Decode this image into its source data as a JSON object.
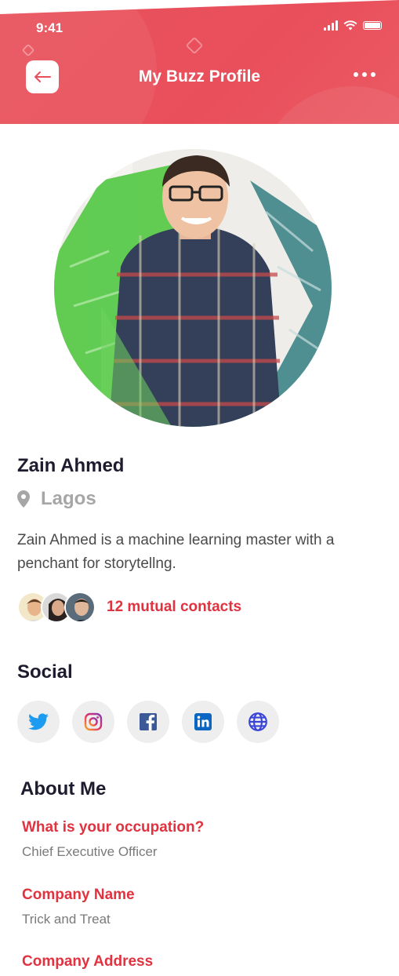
{
  "status_bar": {
    "time": "9:41"
  },
  "header": {
    "title": "My Buzz Profile"
  },
  "profile": {
    "name": "Zain Ahmed",
    "location": "Lagos",
    "bio": "Zain Ahmed is a machine learning master with a penchant for storytellng.",
    "mutual_contacts": "12 mutual contacts"
  },
  "social": {
    "title": "Social",
    "links": [
      "twitter-icon",
      "instagram-icon",
      "facebook-icon",
      "linkedin-icon",
      "globe-icon"
    ]
  },
  "about": {
    "title": "About Me",
    "items": [
      {
        "question": "What is your occupation?",
        "answer": "Chief Executive Officer"
      },
      {
        "question": "Company Name",
        "answer": "Trick and Treat"
      },
      {
        "question": "Company Address",
        "answer": ""
      }
    ]
  },
  "colors": {
    "accent": "#e94f5b",
    "link_red": "#e0323f",
    "heading": "#1d1b2e"
  }
}
